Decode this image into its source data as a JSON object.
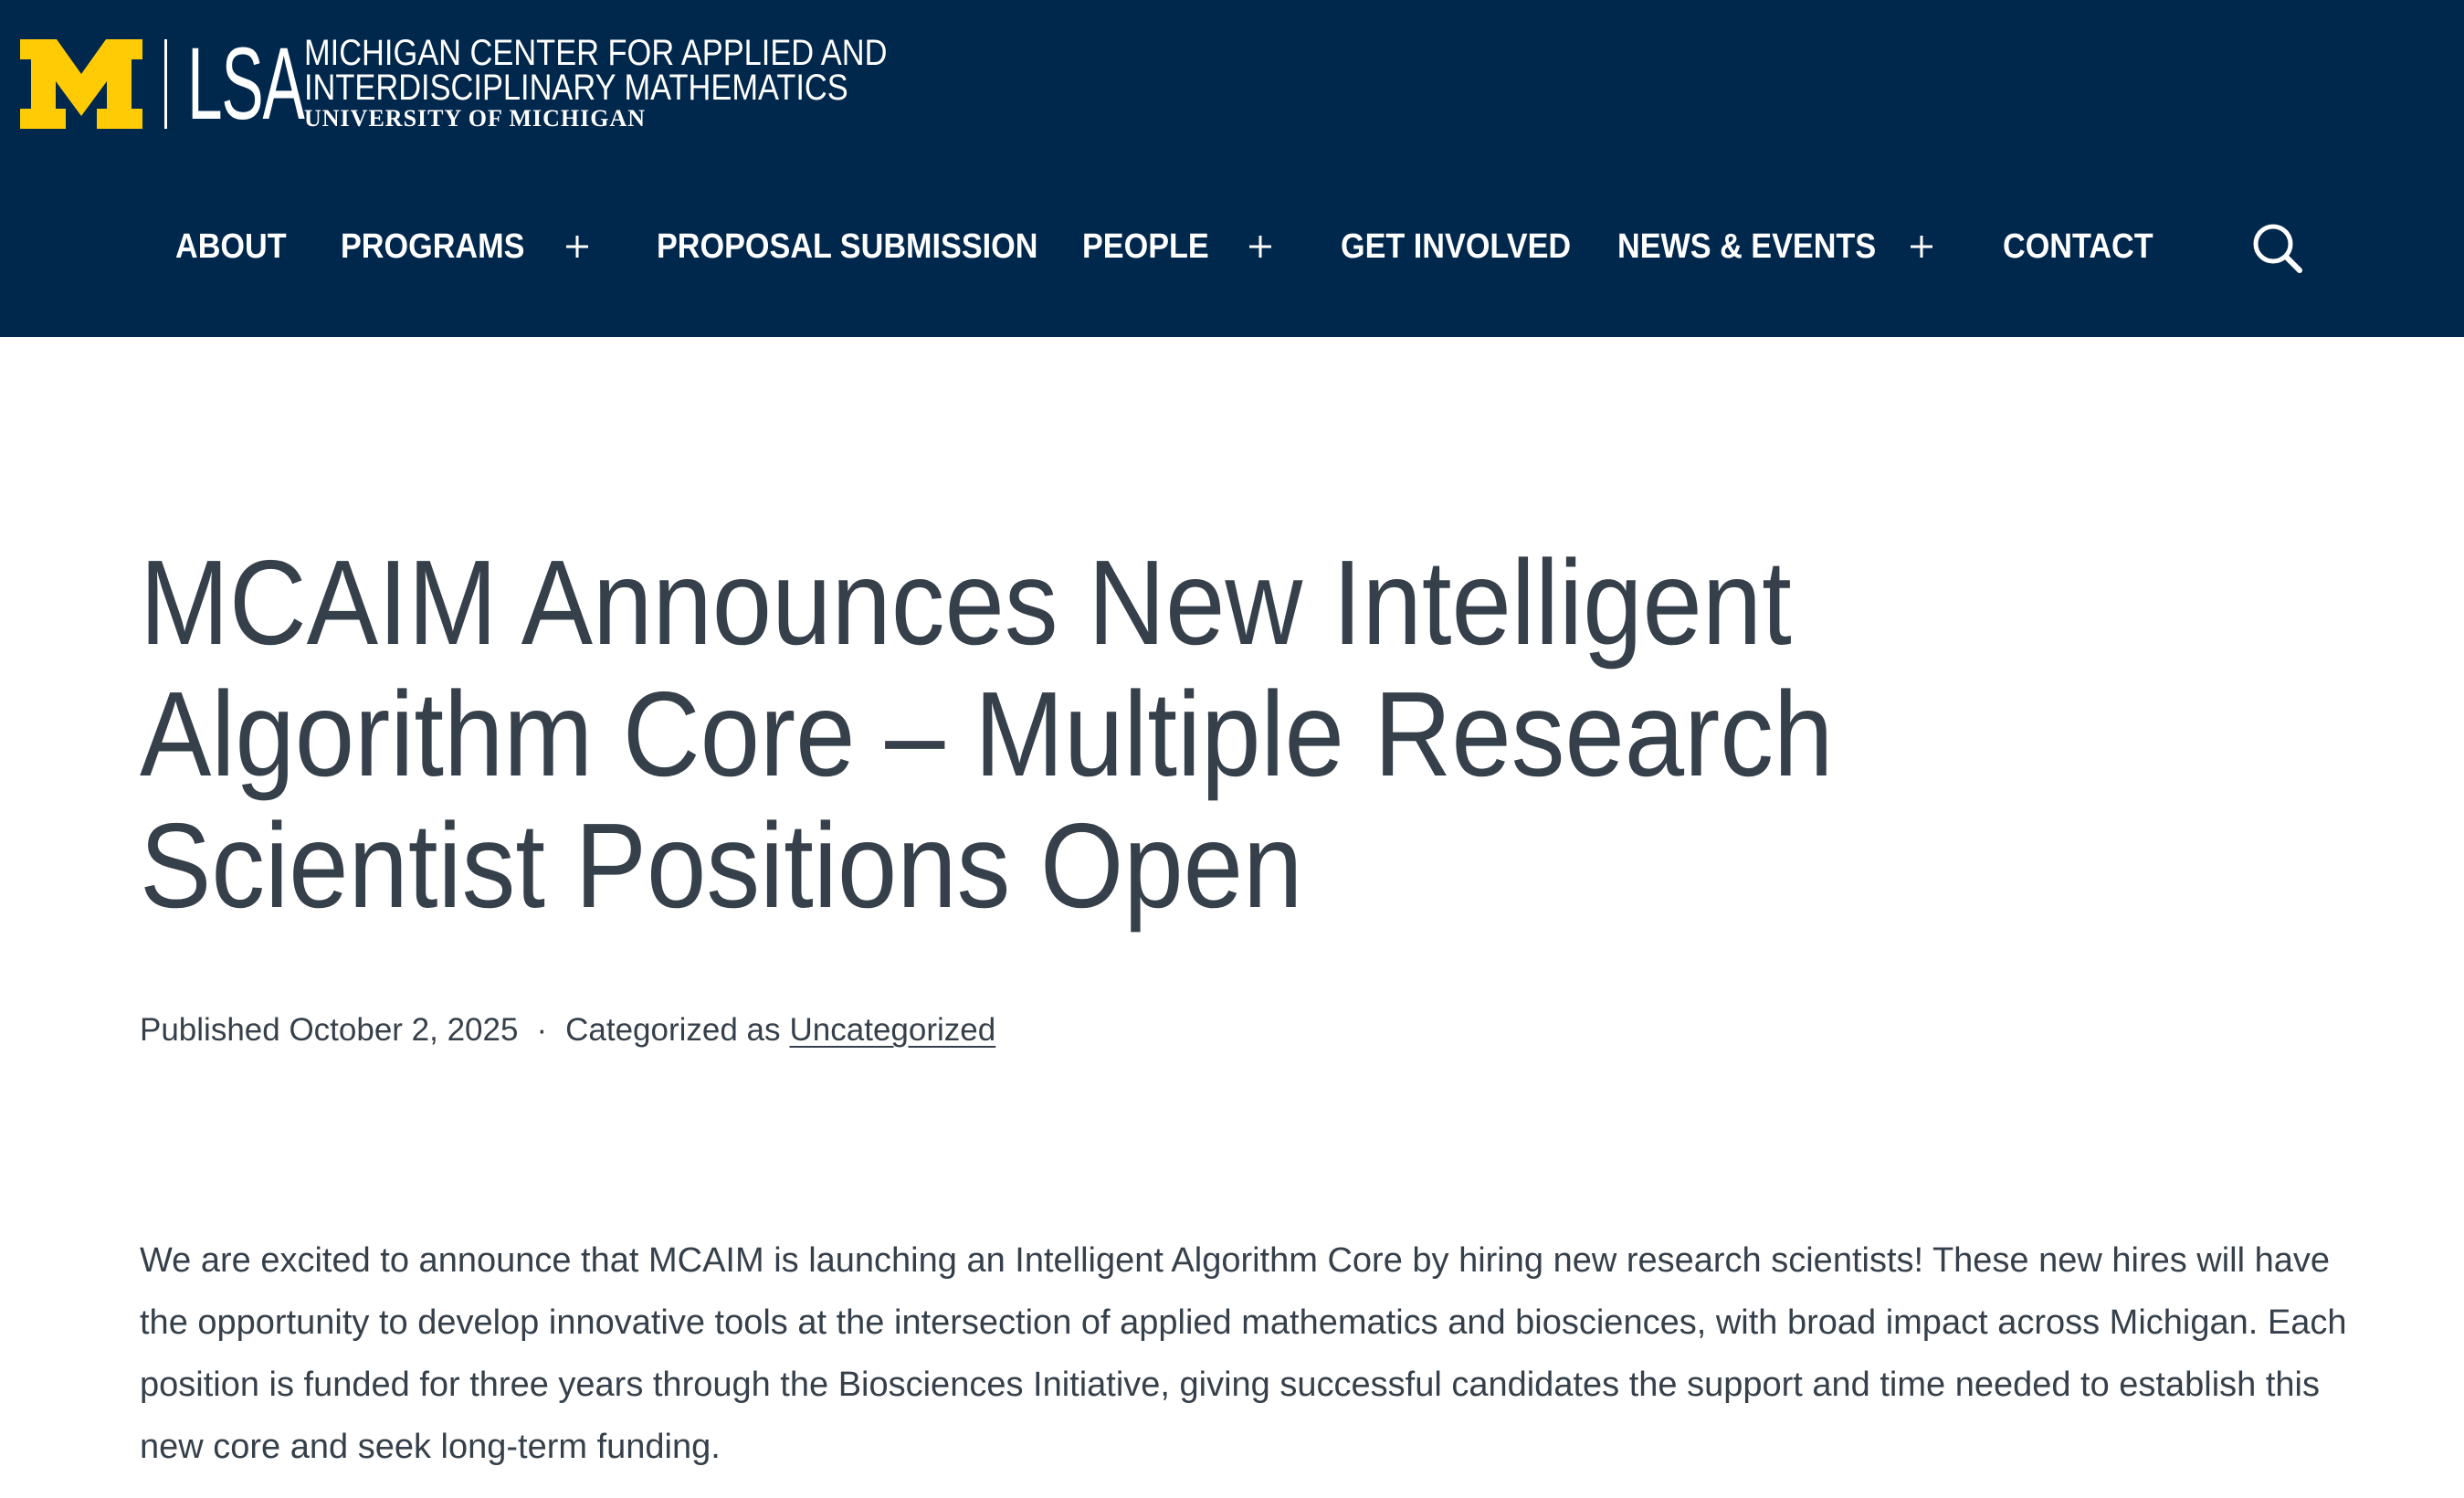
{
  "header": {
    "logo": {
      "block_m": "M",
      "lsa": "LSA",
      "unit_line1": "MICHIGAN CENTER FOR APPLIED AND",
      "unit_line2": "INTERDISCIPLINARY MATHEMATICS",
      "university": "UNIVERSITY OF MICHIGAN",
      "brand_color": "#ffcb05"
    },
    "background_color": "#00274c",
    "nav": {
      "items": [
        {
          "label": "ABOUT",
          "has_submenu": false
        },
        {
          "label": "PROGRAMS",
          "has_submenu": true
        },
        {
          "label": "PROPOSAL SUBMISSION",
          "has_submenu": false
        },
        {
          "label": "PEOPLE",
          "has_submenu": true
        },
        {
          "label": "GET INVOLVED",
          "has_submenu": false
        },
        {
          "label": "NEWS & EVENTS",
          "has_submenu": true
        },
        {
          "label": "CONTACT",
          "has_submenu": false
        }
      ],
      "expand_icon": "plus-icon",
      "search_icon": "search-icon"
    }
  },
  "article": {
    "title": "MCAIM Announces New Intelligent Algorithm Core – Multiple Research Scientist Positions Open",
    "meta": {
      "published": "Published October 2, 2025",
      "separator": "·",
      "categorized_prefix": "Categorized as",
      "category": "Uncategorized"
    },
    "body": "We are excited to announce that MCAIM is launching an Intelligent Algorithm Core by hiring new research scientists! These new hires will have the opportunity to develop innovative tools at the intersection of applied mathematics and biosciences, with broad impact across Michigan. Each position is funded for three years through the Biosciences Initiative, giving successful candidates the support and time needed to establish this new core and seek long-term funding."
  },
  "colors": {
    "navy": "#00274c",
    "maize": "#ffcb05",
    "text": "#36404a"
  }
}
